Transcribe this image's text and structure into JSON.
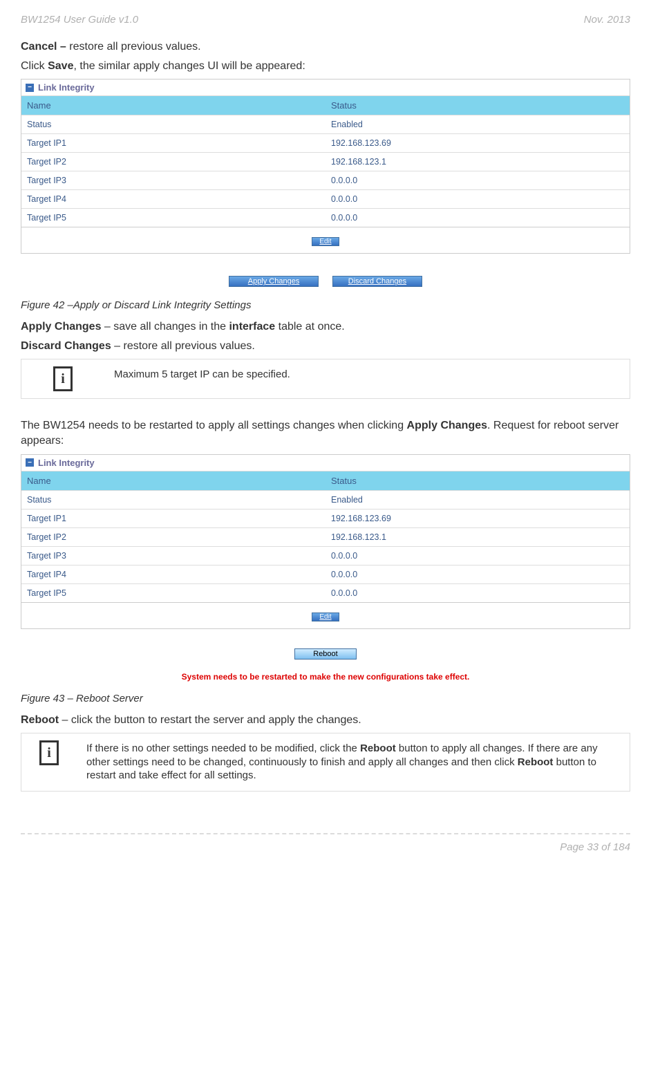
{
  "header": {
    "left": "BW1254 User Guide v1.0",
    "right": "Nov.  2013"
  },
  "para1": {
    "b": "Cancel – ",
    "rest": "restore all previous values."
  },
  "para2": {
    "pre": "Click ",
    "b": "Save",
    "post": ", the similar apply changes UI will be appeared:"
  },
  "table": {
    "title": "Link Integrity",
    "head": {
      "c1": "Name",
      "c2": "Status"
    },
    "rows": [
      {
        "c1": "Status",
        "c2": "Enabled"
      },
      {
        "c1": "Target IP1",
        "c2": "192.168.123.69"
      },
      {
        "c1": "Target IP2",
        "c2": "192.168.123.1"
      },
      {
        "c1": "Target IP3",
        "c2": "0.0.0.0"
      },
      {
        "c1": "Target IP4",
        "c2": "0.0.0.0"
      },
      {
        "c1": "Target IP5",
        "c2": "0.0.0.0"
      }
    ],
    "edit": "Edit"
  },
  "buttons1": {
    "apply": "Apply Changes",
    "discard": "Discard Changes"
  },
  "fig42": "Figure 42 –Apply or Discard Link Integrity Settings",
  "apply_line": {
    "b": "Apply Changes",
    "rest": " – save all changes in the ",
    "b2": "interface",
    "rest2": " table at once."
  },
  "discard_line": {
    "b": "Discard Changes",
    "rest": " – restore all previous values."
  },
  "info1": "Maximum 5 target IP can be specified.",
  "restart_para": {
    "pre": "The BW1254 needs to be restarted to apply all settings changes when clicking ",
    "b": "Apply Changes",
    "post": ". Request for reboot server appears:"
  },
  "reboot_btn": "Reboot",
  "restart_msg": "System needs to be restarted to make the new configurations take effect.",
  "fig43": "Figure 43 – Reboot Server",
  "reboot_line": {
    "b": "Reboot",
    "rest": " – click the button to restart the server and apply the changes."
  },
  "info2": {
    "p1": "If there is no other settings needed to be modified, click the ",
    "b1": "Reboot",
    "p2": " button to apply all changes. If there are any other settings need to be changed, continuously to finish and apply all changes and then click ",
    "b2": "Reboot",
    "p3": " button to restart and take effect  for all settings."
  },
  "footer": "Page 33 of 184"
}
